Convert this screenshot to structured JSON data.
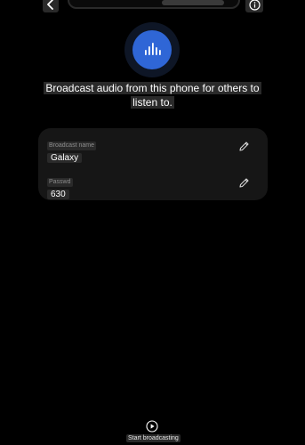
{
  "header": {
    "back_icon": "chevron-left-icon",
    "info_icon": "info-icon"
  },
  "hero": {
    "icon": "broadcast-audio-icon",
    "accent_color": "#2f66d6"
  },
  "description": "Broadcast audio from this phone for others to listen to.",
  "settings": {
    "broadcast_name": {
      "label": "Broadcast name",
      "value": "Galaxy",
      "edit_icon": "pencil-icon"
    },
    "password": {
      "label": "Passwd",
      "value": "630",
      "edit_icon": "pencil-icon"
    }
  },
  "footer": {
    "start_icon": "play-circle-icon",
    "start_label": "Start broadcasting"
  }
}
